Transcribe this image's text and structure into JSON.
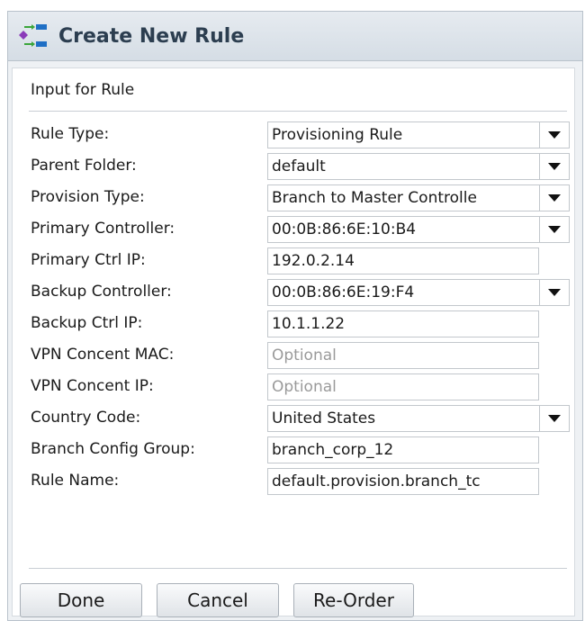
{
  "dialog": {
    "title": "Create New Rule",
    "section_title": "Input for Rule"
  },
  "fields": [
    {
      "label": "Rule Type:",
      "value": "Provisioning Rule",
      "type": "select"
    },
    {
      "label": "Parent Folder:",
      "value": "default",
      "type": "select"
    },
    {
      "label": "Provision Type:",
      "value": "Branch to Master Controlle",
      "type": "select"
    },
    {
      "label": "Primary Controller:",
      "value": "00:0B:86:6E:10:B4",
      "type": "select"
    },
    {
      "label": "Primary Ctrl IP:",
      "value": "192.0.2.14",
      "type": "text"
    },
    {
      "label": "Backup Controller:",
      "value": "00:0B:86:6E:19:F4",
      "type": "select"
    },
    {
      "label": "Backup Ctrl IP:",
      "value": "10.1.1.22",
      "type": "text"
    },
    {
      "label": "VPN Concent MAC:",
      "value": "",
      "placeholder": "Optional",
      "type": "text"
    },
    {
      "label": "VPN Concent IP:",
      "value": "",
      "placeholder": "Optional",
      "type": "text"
    },
    {
      "label": "Country Code:",
      "value": "United States",
      "type": "select"
    },
    {
      "label": "Branch Config Group:",
      "value": "branch_corp_12",
      "type": "text"
    },
    {
      "label": "Rule Name:",
      "value": "default.provision.branch_tc",
      "type": "text"
    }
  ],
  "buttons": {
    "done": "Done",
    "cancel": "Cancel",
    "reorder": "Re-Order"
  },
  "icons": {
    "title_icon": "rule-flow-icon"
  },
  "colors": {
    "titlebar": "#dbe2e9",
    "title_text": "#2c3e50",
    "icon_green": "#3aa53a",
    "icon_purple": "#8a3ab9",
    "icon_blue": "#1f6fc5"
  }
}
